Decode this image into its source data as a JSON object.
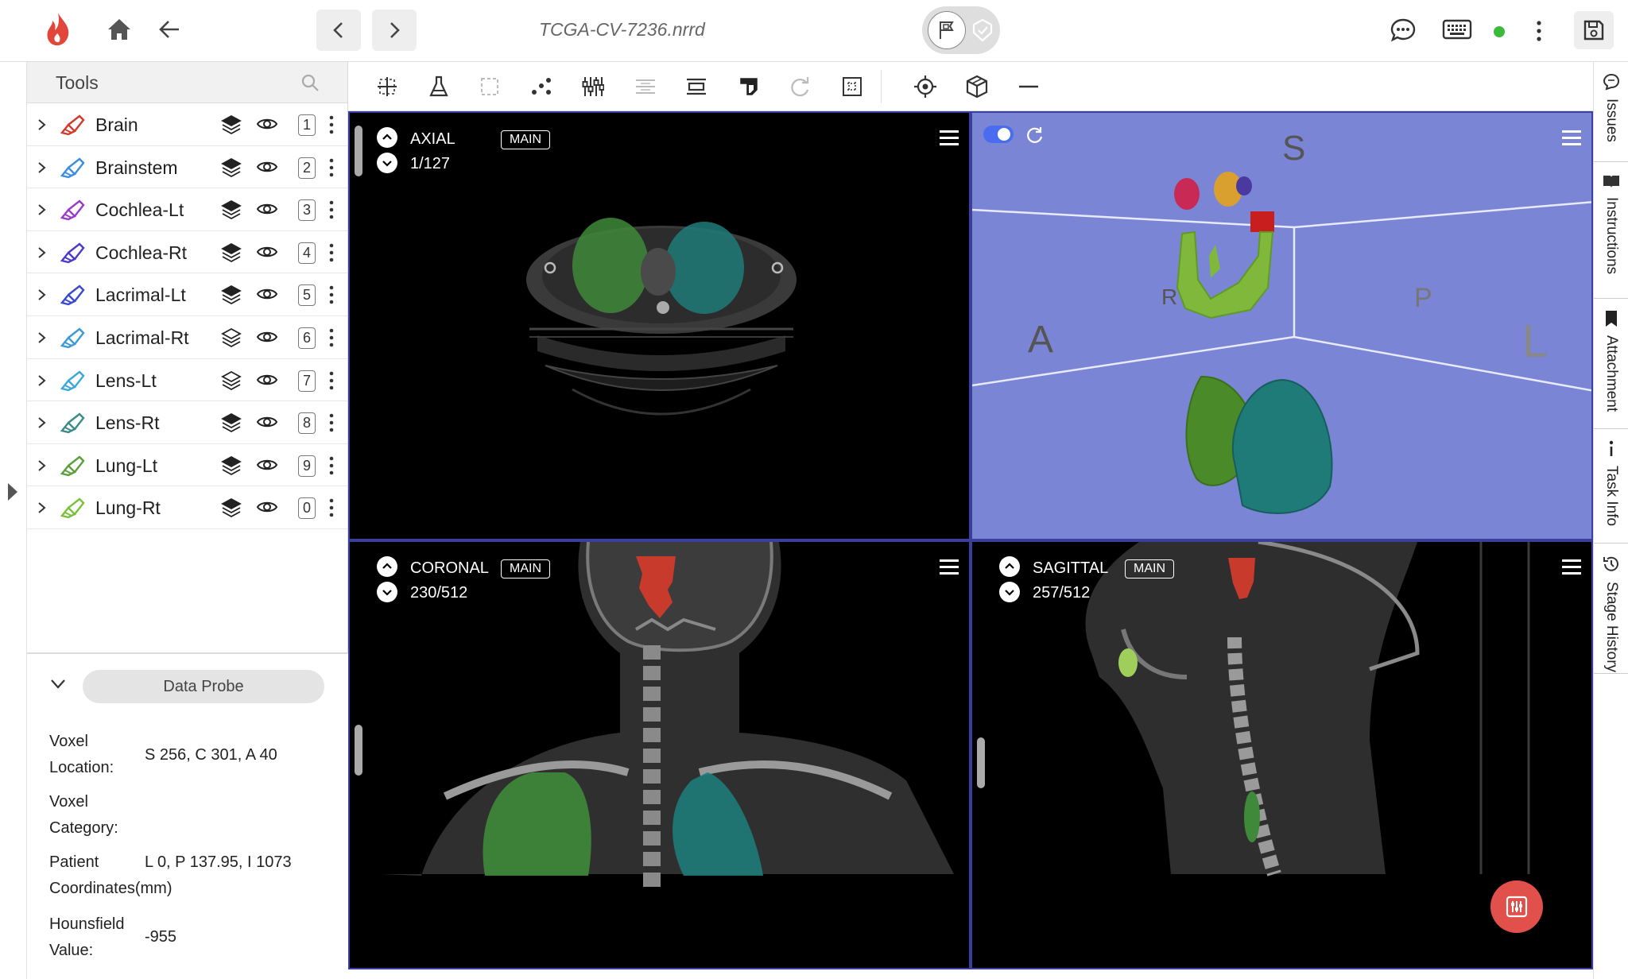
{
  "topbar": {
    "filename": "TCGA-CV-7236.nrrd",
    "status_color": "#3cba3c"
  },
  "sidebar": {
    "tools_title": "Tools",
    "labels": [
      {
        "name": "Brain",
        "key": "1",
        "color": "#d43a2a",
        "layers_filled": true
      },
      {
        "name": "Brainstem",
        "key": "2",
        "color": "#3a8ee0",
        "layers_filled": true
      },
      {
        "name": "Cochlea-Lt",
        "key": "3",
        "color": "#9a3ac9",
        "layers_filled": true
      },
      {
        "name": "Cochlea-Rt",
        "key": "4",
        "color": "#4a3ac9",
        "layers_filled": true
      },
      {
        "name": "Lacrimal-Lt",
        "key": "5",
        "color": "#3a4ad0",
        "layers_filled": true
      },
      {
        "name": "Lacrimal-Rt",
        "key": "6",
        "color": "#3a9ad8",
        "layers_filled": false
      },
      {
        "name": "Lens-Lt",
        "key": "7",
        "color": "#3aa8d8",
        "layers_filled": false
      },
      {
        "name": "Lens-Rt",
        "key": "8",
        "color": "#3a8a8a",
        "layers_filled": true
      },
      {
        "name": "Lung-Lt",
        "key": "9",
        "color": "#5aa03a",
        "layers_filled": true
      },
      {
        "name": "Lung-Rt",
        "key": "0",
        "color": "#7ac03a",
        "layers_filled": true
      }
    ]
  },
  "probe": {
    "title": "Data Probe",
    "voxel_location_label_1": "Voxel",
    "voxel_location_label_2": "Location:",
    "voxel_location_value": "S 256, C 301, A 40",
    "voxel_category_label_1": "Voxel",
    "voxel_category_label_2": "Category:",
    "patient_coord_label_1": "Patient",
    "patient_coord_label_2": "Coordinates(mm)",
    "patient_coord_value": "L 0, P 137.95, I 1073",
    "hu_label_1": "Hounsfield",
    "hu_label_2": "Value:",
    "hu_value": "-955"
  },
  "viewports": {
    "axial": {
      "name": "AXIAL",
      "badge": "MAIN",
      "slice": "1/127"
    },
    "coronal": {
      "name": "CORONAL",
      "badge": "MAIN",
      "slice": "230/512"
    },
    "sagittal": {
      "name": "SAGITTAL",
      "badge": "MAIN",
      "slice": "257/512"
    },
    "three_d": {
      "bg_color": "#7b85d6",
      "orient_s": "S",
      "orient_a": "A",
      "orient_r": "R",
      "orient_p": "P",
      "orient_l": "L"
    }
  },
  "right_tabs": [
    {
      "label": "Issues",
      "icon": "chat-icon"
    },
    {
      "label": "Instructions",
      "icon": "book-icon"
    },
    {
      "label": "Attachment",
      "icon": "bookmark-icon"
    },
    {
      "label": "Task Info",
      "icon": "info-icon"
    },
    {
      "label": "Stage History",
      "icon": "history-icon"
    }
  ],
  "colors": {
    "accent_fab": "#e2504c",
    "lung_left": "#3f8a3a",
    "lung_right": "#1e7b78",
    "brain": "#c83a2c"
  }
}
